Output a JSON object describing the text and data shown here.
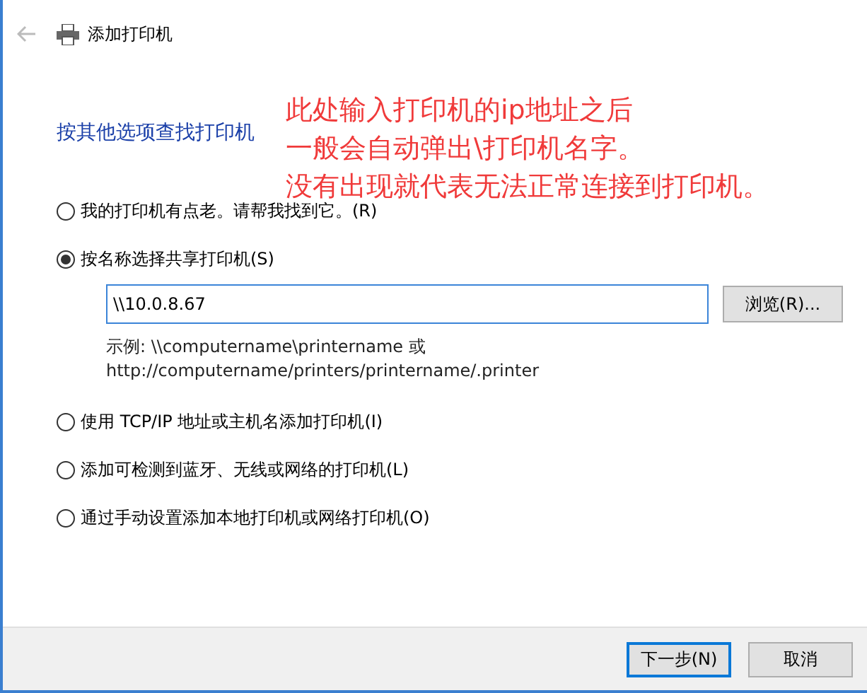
{
  "window": {
    "title": "添加打印机"
  },
  "link": "按其他选项查找打印机",
  "annotation": [
    "此处输入打印机的ip地址之后",
    "一般会自动弹出\\打印机名字。",
    "没有出现就代表无法正常连接到打印机。"
  ],
  "options": [
    {
      "label": "我的打印机有点老。请帮我找到它。(R)",
      "selected": false
    },
    {
      "label": "按名称选择共享打印机(S)",
      "selected": true,
      "field": {
        "value": "\\\\10.0.8.67"
      },
      "browse": "浏览(R)...",
      "hint": [
        "示例: \\\\computername\\printername 或",
        "http://computername/printers/printername/.printer"
      ]
    },
    {
      "label": "使用 TCP/IP 地址或主机名添加打印机(I)",
      "selected": false
    },
    {
      "label": "添加可检测到蓝牙、无线或网络的打印机(L)",
      "selected": false
    },
    {
      "label": "通过手动设置添加本地打印机或网络打印机(O)",
      "selected": false
    }
  ],
  "buttons": [
    {
      "label": "下一步(N)",
      "kind": "default"
    },
    {
      "label": "取消",
      "kind": "normal"
    }
  ]
}
